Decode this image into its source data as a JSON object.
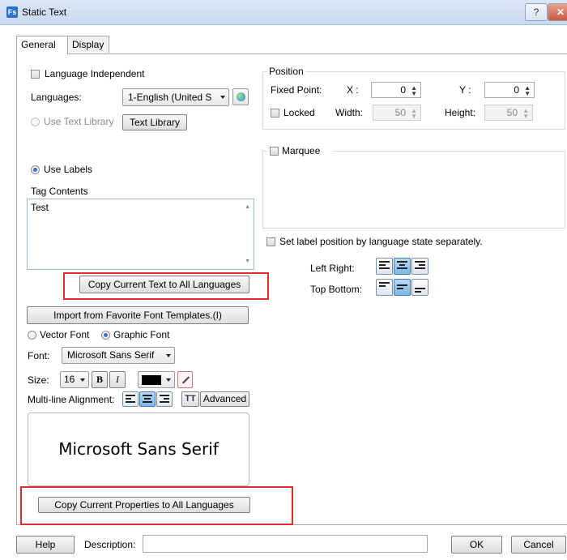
{
  "window": {
    "app_icon": "Fs",
    "title": "Static Text",
    "help_label": "?",
    "close_label": "✕"
  },
  "tabs": [
    {
      "label": "General"
    },
    {
      "label": "Display"
    }
  ],
  "general": {
    "language_independent": "Language Independent",
    "languages_label": "Languages:",
    "language_value": "1-English (United S",
    "use_text_library": "Use Text Library",
    "text_library_button": "Text Library",
    "use_labels": "Use Labels",
    "tag_contents_label": "Tag Contents",
    "tag_contents_value": "Test",
    "copy_text_button": "Copy Current Text to All Languages",
    "import_button": "Import from Favorite Font Templates.(I)",
    "vector_font": "Vector Font",
    "graphic_font": "Graphic Font",
    "font_label": "Font:",
    "font_value": "Microsoft Sans Serif",
    "size_label": "Size:",
    "size_value": "16",
    "bold_label": "B",
    "italic_label": "I",
    "multiline_label": "Multi-line Alignment:",
    "tt_label": "TT",
    "advanced_button": "Advanced",
    "preview_text": "Microsoft Sans Serif",
    "copy_props_button": "Copy Current Properties to All Languages"
  },
  "position": {
    "legend": "Position",
    "fixed_point": "Fixed Point:",
    "x_label": "X :",
    "x_value": "0",
    "y_label": "Y :",
    "y_value": "0",
    "locked": "Locked",
    "width_label": "Width:",
    "width_value": "50",
    "height_label": "Height:",
    "height_value": "50"
  },
  "marquee": {
    "label": "Marquee"
  },
  "label_position": {
    "set_separately": "Set label position by language  state separately.",
    "left_right": "Left Right:",
    "top_bottom": "Top Bottom:"
  },
  "footer": {
    "help_button": "Help",
    "description_label": "Description:",
    "description_value": "",
    "ok_button": "OK",
    "cancel_button": "Cancel"
  },
  "colors": {
    "highlight_red": "#e52b2b",
    "selected_blue": "#7ab6e9",
    "font_color": "#000000"
  }
}
